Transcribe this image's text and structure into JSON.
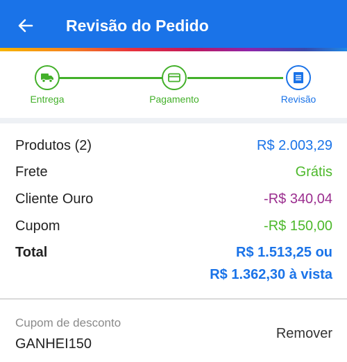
{
  "header": {
    "title": "Revisão do Pedido",
    "back_icon": "arrow-left-icon",
    "background_color": "#1a73e8"
  },
  "stepper": {
    "steps": [
      {
        "label": "Entrega",
        "icon": "truck-icon",
        "state": "done"
      },
      {
        "label": "Pagamento",
        "icon": "credit-card-icon",
        "state": "done"
      },
      {
        "label": "Revisão",
        "icon": "receipt-icon",
        "state": "active"
      }
    ],
    "done_color": "#43b02a",
    "active_color": "#1a73e8"
  },
  "summary": {
    "products_label": "Produtos (2)",
    "products_value": "R$ 2.003,29",
    "shipping_label": "Frete",
    "shipping_value": "Grátis",
    "gold_client_label": "Cliente Ouro",
    "gold_client_value": "-R$ 340,04",
    "coupon_label": "Cupom",
    "coupon_value": "-R$ 150,00",
    "total_label": "Total",
    "total_value_line1": "R$ 1.513,25 ou",
    "total_value_line2": "R$ 1.362,30 à vista"
  },
  "coupon": {
    "label": "Cupom de desconto",
    "code": "GANHEI150",
    "remove_label": "Remover"
  }
}
